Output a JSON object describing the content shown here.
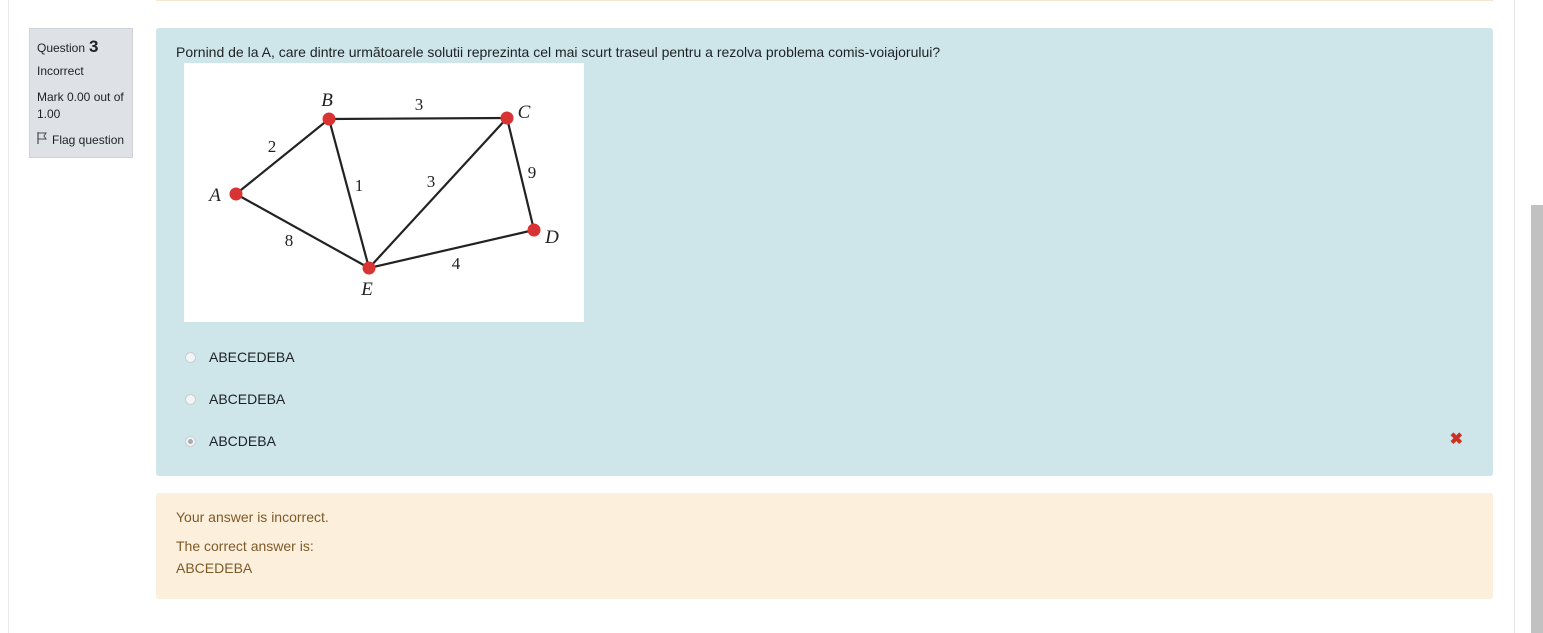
{
  "question_info": {
    "label": "Question",
    "number": "3",
    "state": "Incorrect",
    "grade": "Mark 0.00 out of 1.00",
    "flag_label": "Flag question"
  },
  "question": {
    "text": "Pornind de la A, care dintre următoarele solutii reprezinta cel mai scurt traseul pentru a rezolva problema comis-voiajorului?",
    "graph": {
      "nodes": [
        "A",
        "B",
        "C",
        "D",
        "E"
      ],
      "edges": [
        {
          "from": "A",
          "to": "B",
          "weight": "2"
        },
        {
          "from": "B",
          "to": "C",
          "weight": "3"
        },
        {
          "from": "B",
          "to": "E",
          "weight": "1"
        },
        {
          "from": "C",
          "to": "E",
          "weight": "3"
        },
        {
          "from": "C",
          "to": "D",
          "weight": "9"
        },
        {
          "from": "A",
          "to": "E",
          "weight": "8"
        },
        {
          "from": "E",
          "to": "D",
          "weight": "4"
        }
      ],
      "node_color": "#d93434",
      "edge_color": "#222222"
    }
  },
  "answers": [
    {
      "label": "ABECEDEBA",
      "selected": false
    },
    {
      "label": "ABCEDEBA",
      "selected": false
    },
    {
      "label": "ABCDEBA",
      "selected": true
    }
  ],
  "outcome": {
    "feedback": "Your answer is incorrect.",
    "right_answer_label": "The correct answer is:",
    "right_answer_value": "ABCEDEBA"
  },
  "colors": {
    "formulation_bg": "#cee6ea",
    "outcome_bg": "#fcefdc",
    "outcome_text": "#7d5a29",
    "incorrect_icon": "#ca3120"
  }
}
